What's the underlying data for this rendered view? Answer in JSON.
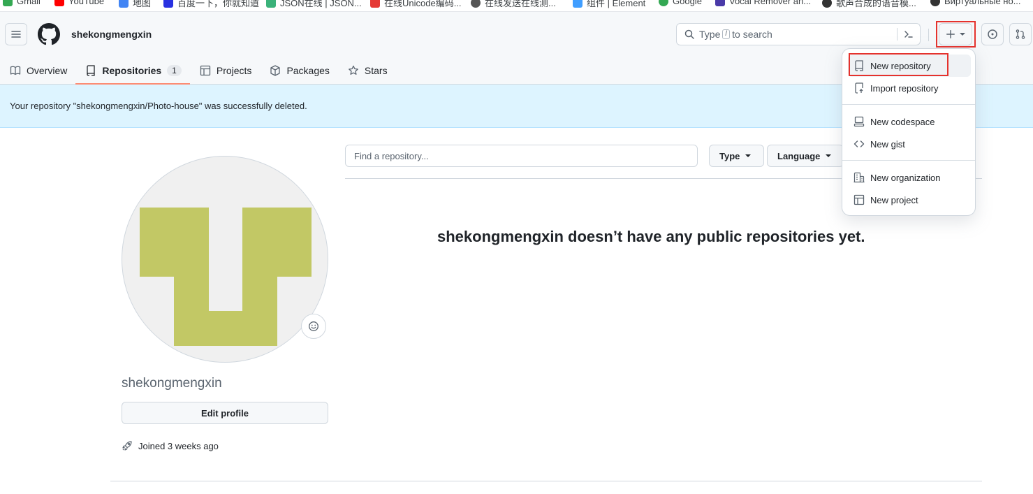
{
  "bookmarks": [
    {
      "label": "Gmail",
      "color": "#34a853"
    },
    {
      "label": "YouTube",
      "color": "#ff0000"
    },
    {
      "label": "地图",
      "color": "#4285f4"
    },
    {
      "label": "百度一下，你就知道",
      "color": "#2932e1"
    },
    {
      "label": "JSON在线 | JSON...",
      "color": "#3bb27a"
    },
    {
      "label": "在线Unicode编码...",
      "color": "#e53935"
    },
    {
      "label": "在线发送在线测...",
      "color": "#555555"
    },
    {
      "label": "组件 | Element",
      "color": "#409eff"
    },
    {
      "label": "Google",
      "color": "#34a853"
    },
    {
      "label": "Vocal Remover an...",
      "color": "#4a3aa8"
    },
    {
      "label": "歌声合成的语音模...",
      "color": "#333333"
    },
    {
      "label": "Виртуальные но...",
      "color": "#333333"
    }
  ],
  "header": {
    "username": "shekongmengxin",
    "search": {
      "prefix": "Type",
      "key": "/",
      "suffix": "to search"
    }
  },
  "tabs": [
    {
      "label": "Overview",
      "icon": "book-icon"
    },
    {
      "label": "Repositories",
      "icon": "repo-icon",
      "count": "1",
      "active": true
    },
    {
      "label": "Projects",
      "icon": "table-icon"
    },
    {
      "label": "Packages",
      "icon": "package-icon"
    },
    {
      "label": "Stars",
      "icon": "star-icon"
    }
  ],
  "flash": {
    "message": "Your repository \"shekongmengxin/Photo-house\" was successfully deleted."
  },
  "profile": {
    "name": "shekongmengxin",
    "edit_label": "Edit profile",
    "joined": "Joined 3 weeks ago"
  },
  "repos": {
    "find_placeholder": "Find a repository...",
    "type_label": "Type",
    "language_label": "Language",
    "empty_message": "shekongmengxin doesn’t have any public repositories yet."
  },
  "menu": {
    "items": [
      {
        "label": "New repository",
        "icon": "repo-icon"
      },
      {
        "label": "Import repository",
        "icon": "repo-push-icon"
      },
      {
        "label": "New codespace",
        "icon": "codespaces-icon"
      },
      {
        "label": "New gist",
        "icon": "code-icon"
      },
      {
        "label": "New organization",
        "icon": "organization-icon"
      },
      {
        "label": "New project",
        "icon": "project-icon"
      }
    ]
  },
  "colors": {
    "accent_underline": "#fd8c73",
    "flash_bg": "#ddf4ff",
    "avatar_blocks": "#c2c865",
    "highlight_box": "#e5322d"
  }
}
